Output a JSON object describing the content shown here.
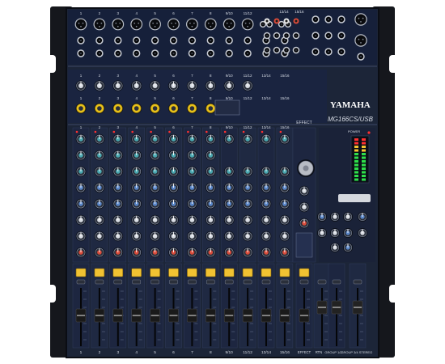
{
  "brand": "YAMAHA",
  "model": "MG166CS/USB",
  "mono_channels": [
    "1",
    "2",
    "3",
    "4",
    "5",
    "6",
    "7",
    "8"
  ],
  "stereo_channels": [
    "9/10",
    "11/12",
    "13/14",
    "15/16"
  ],
  "top_stereo_labels": [
    "13/14",
    "15/16"
  ],
  "effect_label": "EFFECT",
  "bottom_labels": [
    "1",
    "2",
    "3",
    "4",
    "5",
    "6",
    "7",
    "8",
    "9/10",
    "11/12",
    "13/14",
    "15/16",
    "EFFECT",
    "RTN",
    "GROUP 1/2",
    "GROUP 3/4",
    "STEREO"
  ],
  "meter_label": "POWER",
  "colors": {
    "panel": "#1c2538",
    "panel_dark": "#0d1220",
    "chassis": "#15171c",
    "mute_yellow": "#f1c232",
    "knob_teal": "#4aa7b0",
    "knob_blue": "#5a86c8",
    "knob_red": "#d94b3a",
    "meter_green": "#2ee04a",
    "meter_red": "#ff3030"
  }
}
